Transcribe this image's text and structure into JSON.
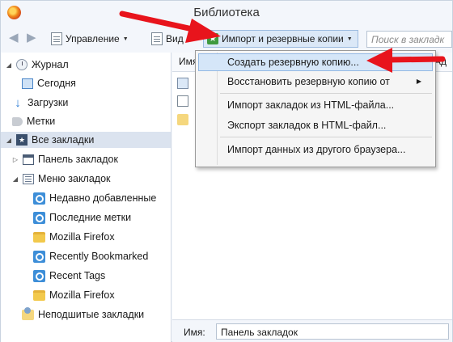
{
  "window": {
    "title": "Библиотека"
  },
  "toolbar": {
    "manage_label": "Управление",
    "view_label": "Вид",
    "import_label": "Импорт и резервные копии",
    "search_placeholder": "Поиск в закладк"
  },
  "tree": [
    {
      "label": "Журнал",
      "icon": "clock-icon"
    },
    {
      "label": "Сегодня",
      "icon": "calendar-icon"
    },
    {
      "label": "Загрузки",
      "icon": "download-arrow-icon"
    },
    {
      "label": "Метки",
      "icon": "tag-icon"
    },
    {
      "label": "Все закладки",
      "icon": "all-bookmarks-star-icon",
      "selected": true
    },
    {
      "label": "Панель закладок",
      "icon": "toolbar-icon"
    },
    {
      "label": "Меню закладок",
      "icon": "bookmarks-menu-icon"
    },
    {
      "label": "Недавно добавленные",
      "icon": "smart-folder-icon"
    },
    {
      "label": "Последние метки",
      "icon": "smart-folder-icon"
    },
    {
      "label": "Mozilla Firefox",
      "icon": "folder-icon"
    },
    {
      "label": "Recently Bookmarked",
      "icon": "smart-folder-icon"
    },
    {
      "label": "Recent Tags",
      "icon": "smart-folder-icon"
    },
    {
      "label": "Mozilla Firefox",
      "icon": "folder-icon"
    },
    {
      "label": "Неподшитые закладки",
      "icon": "unsorted-bookmarks-icon"
    }
  ],
  "content": {
    "column_name": "Имя",
    "column_right": "Ад"
  },
  "menu": {
    "items": [
      {
        "label": "Создать резервную копию...",
        "highlighted": true
      },
      {
        "label": "Восстановить резервную копию от",
        "submenu": true
      },
      {
        "label": "Импорт закладок из HTML-файла..."
      },
      {
        "label": "Экспорт закладок в HTML-файл..."
      },
      {
        "label": "Импорт данных из другого браузера..."
      }
    ]
  },
  "details": {
    "name_label": "Имя:",
    "name_value": "Панель закладок"
  },
  "colors": {
    "annotation_arrow": "#e8141c",
    "menu_highlight": "#d5e6f8",
    "selection": "#dbe3ef"
  }
}
